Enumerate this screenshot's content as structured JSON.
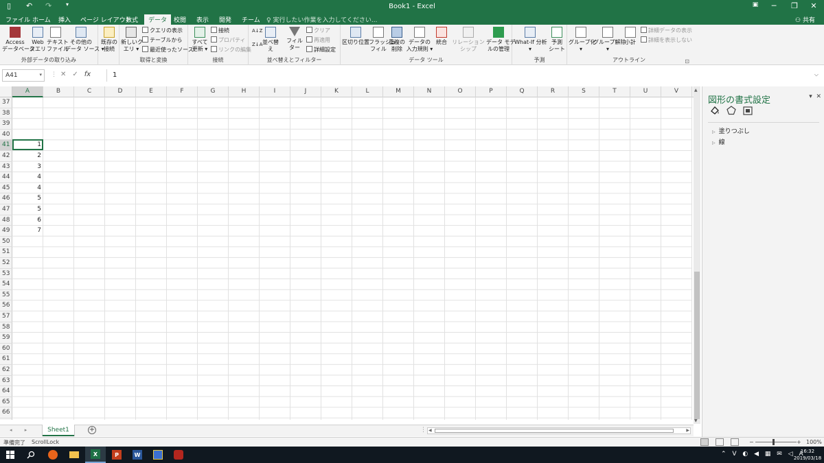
{
  "window": {
    "title": "Book1 - Excel",
    "save_icon": "save-icon",
    "undo": "↶",
    "redo": "↷",
    "minimize": "─",
    "restore": "❐",
    "close": "✕",
    "ribbon_display": "▣"
  },
  "tabs": [
    "ファイル",
    "ホーム",
    "挿入",
    "ページ レイアウト",
    "数式",
    "データ",
    "校閲",
    "表示",
    "開発",
    "チーム"
  ],
  "active_tab": "データ",
  "tell_me": "♀ 実行したい作業を入力してください...",
  "share": "共有",
  "ribbon": {
    "external": {
      "label": "外部データの取り込み",
      "access": "Access\nデータベース",
      "web": "Web\nクエリ",
      "text": "テキスト\nファイル",
      "other": "その他の\nデータ ソース ▾",
      "existing": "既存の\n接続"
    },
    "transform": {
      "label": "取得と変換",
      "newquery": "新しいク\nエリ ▾",
      "show_queries": "クエリの表示",
      "from_table": "テーブルから",
      "recent": "最近使ったソース"
    },
    "connections": {
      "label": "接続",
      "refresh": "すべて\n更新 ▾",
      "connections": "接続",
      "properties": "プロパティ",
      "edit_links": "リンクの編集"
    },
    "sortfilter": {
      "label": "並べ替えとフィルター",
      "sort": "並べ替え",
      "filter": "フィルター",
      "clear": "クリア",
      "reapply": "再適用",
      "advanced": "詳細設定"
    },
    "datatools": {
      "label": "データ ツール",
      "text_to_cols": "区切り位置",
      "flash_fill": "フラッシュ\nフィル",
      "remove_dup": "重複の\n削除",
      "validation": "データの\n入力規則 ▾",
      "consolidate": "統合",
      "relationships": "リレーションシップ",
      "data_model": "データ モデ\nルの管理"
    },
    "forecast": {
      "label": "予測",
      "whatif": "What-If 分析\n▾",
      "sheet": "予測\nシート"
    },
    "outline": {
      "label": "アウトライン",
      "group": "グループ化\n▾",
      "ungroup": "グループ解除\n▾",
      "subtotal": "小計",
      "show_detail": "詳細データの表示",
      "hide_detail": "詳細を表示しない",
      "launcher": "⊡"
    }
  },
  "formula_bar": {
    "name_box": "A41",
    "cancel": "✕",
    "enter": "✓",
    "fx": "fx",
    "value": "1",
    "expand": "⌵"
  },
  "columns": [
    "A",
    "B",
    "C",
    "D",
    "E",
    "F",
    "G",
    "H",
    "I",
    "J",
    "K",
    "L",
    "M",
    "N",
    "O",
    "P",
    "Q",
    "R",
    "S",
    "T",
    "U",
    "V"
  ],
  "rows": [
    "37",
    "38",
    "39",
    "40",
    "41",
    "42",
    "43",
    "44",
    "45",
    "46",
    "47",
    "48",
    "49",
    "50",
    "51",
    "52",
    "53",
    "54",
    "55",
    "56",
    "57",
    "58",
    "59",
    "60",
    "61",
    "62",
    "63",
    "64",
    "65",
    "66",
    "67"
  ],
  "cells": {
    "41": "1",
    "42": "2",
    "43": "3",
    "44": "4",
    "45": "4",
    "46": "5",
    "47": "5",
    "48": "6",
    "49": "7"
  },
  "selected_cell": "A41",
  "sheet_tabs": [
    "Sheet1"
  ],
  "add_sheet": "⊕",
  "sheet_nav": "◂ ▸",
  "pane": {
    "title": "図形の書式設定",
    "options": "▾",
    "close": "✕",
    "sections": [
      "塗りつぶし",
      "線"
    ]
  },
  "status": {
    "ready": "準備完了",
    "scroll_lock": "ScrollLock",
    "zoom": "100%",
    "zoom_minus": "−",
    "zoom_plus": "+"
  },
  "taskbar": {
    "apps": [
      "windows-start",
      "search",
      "firefox",
      "file-explorer",
      "excel",
      "powerpoint",
      "word",
      "app-blue",
      "app-red"
    ],
    "tray": "⌃ V ◐ ◀ ▦ ✉ ◁ A",
    "time": "16:32",
    "date": "2019/03/18"
  },
  "colors": {
    "excel_green": "#217346",
    "chrome": "#f3f3f3",
    "taskbar": "#101820"
  }
}
